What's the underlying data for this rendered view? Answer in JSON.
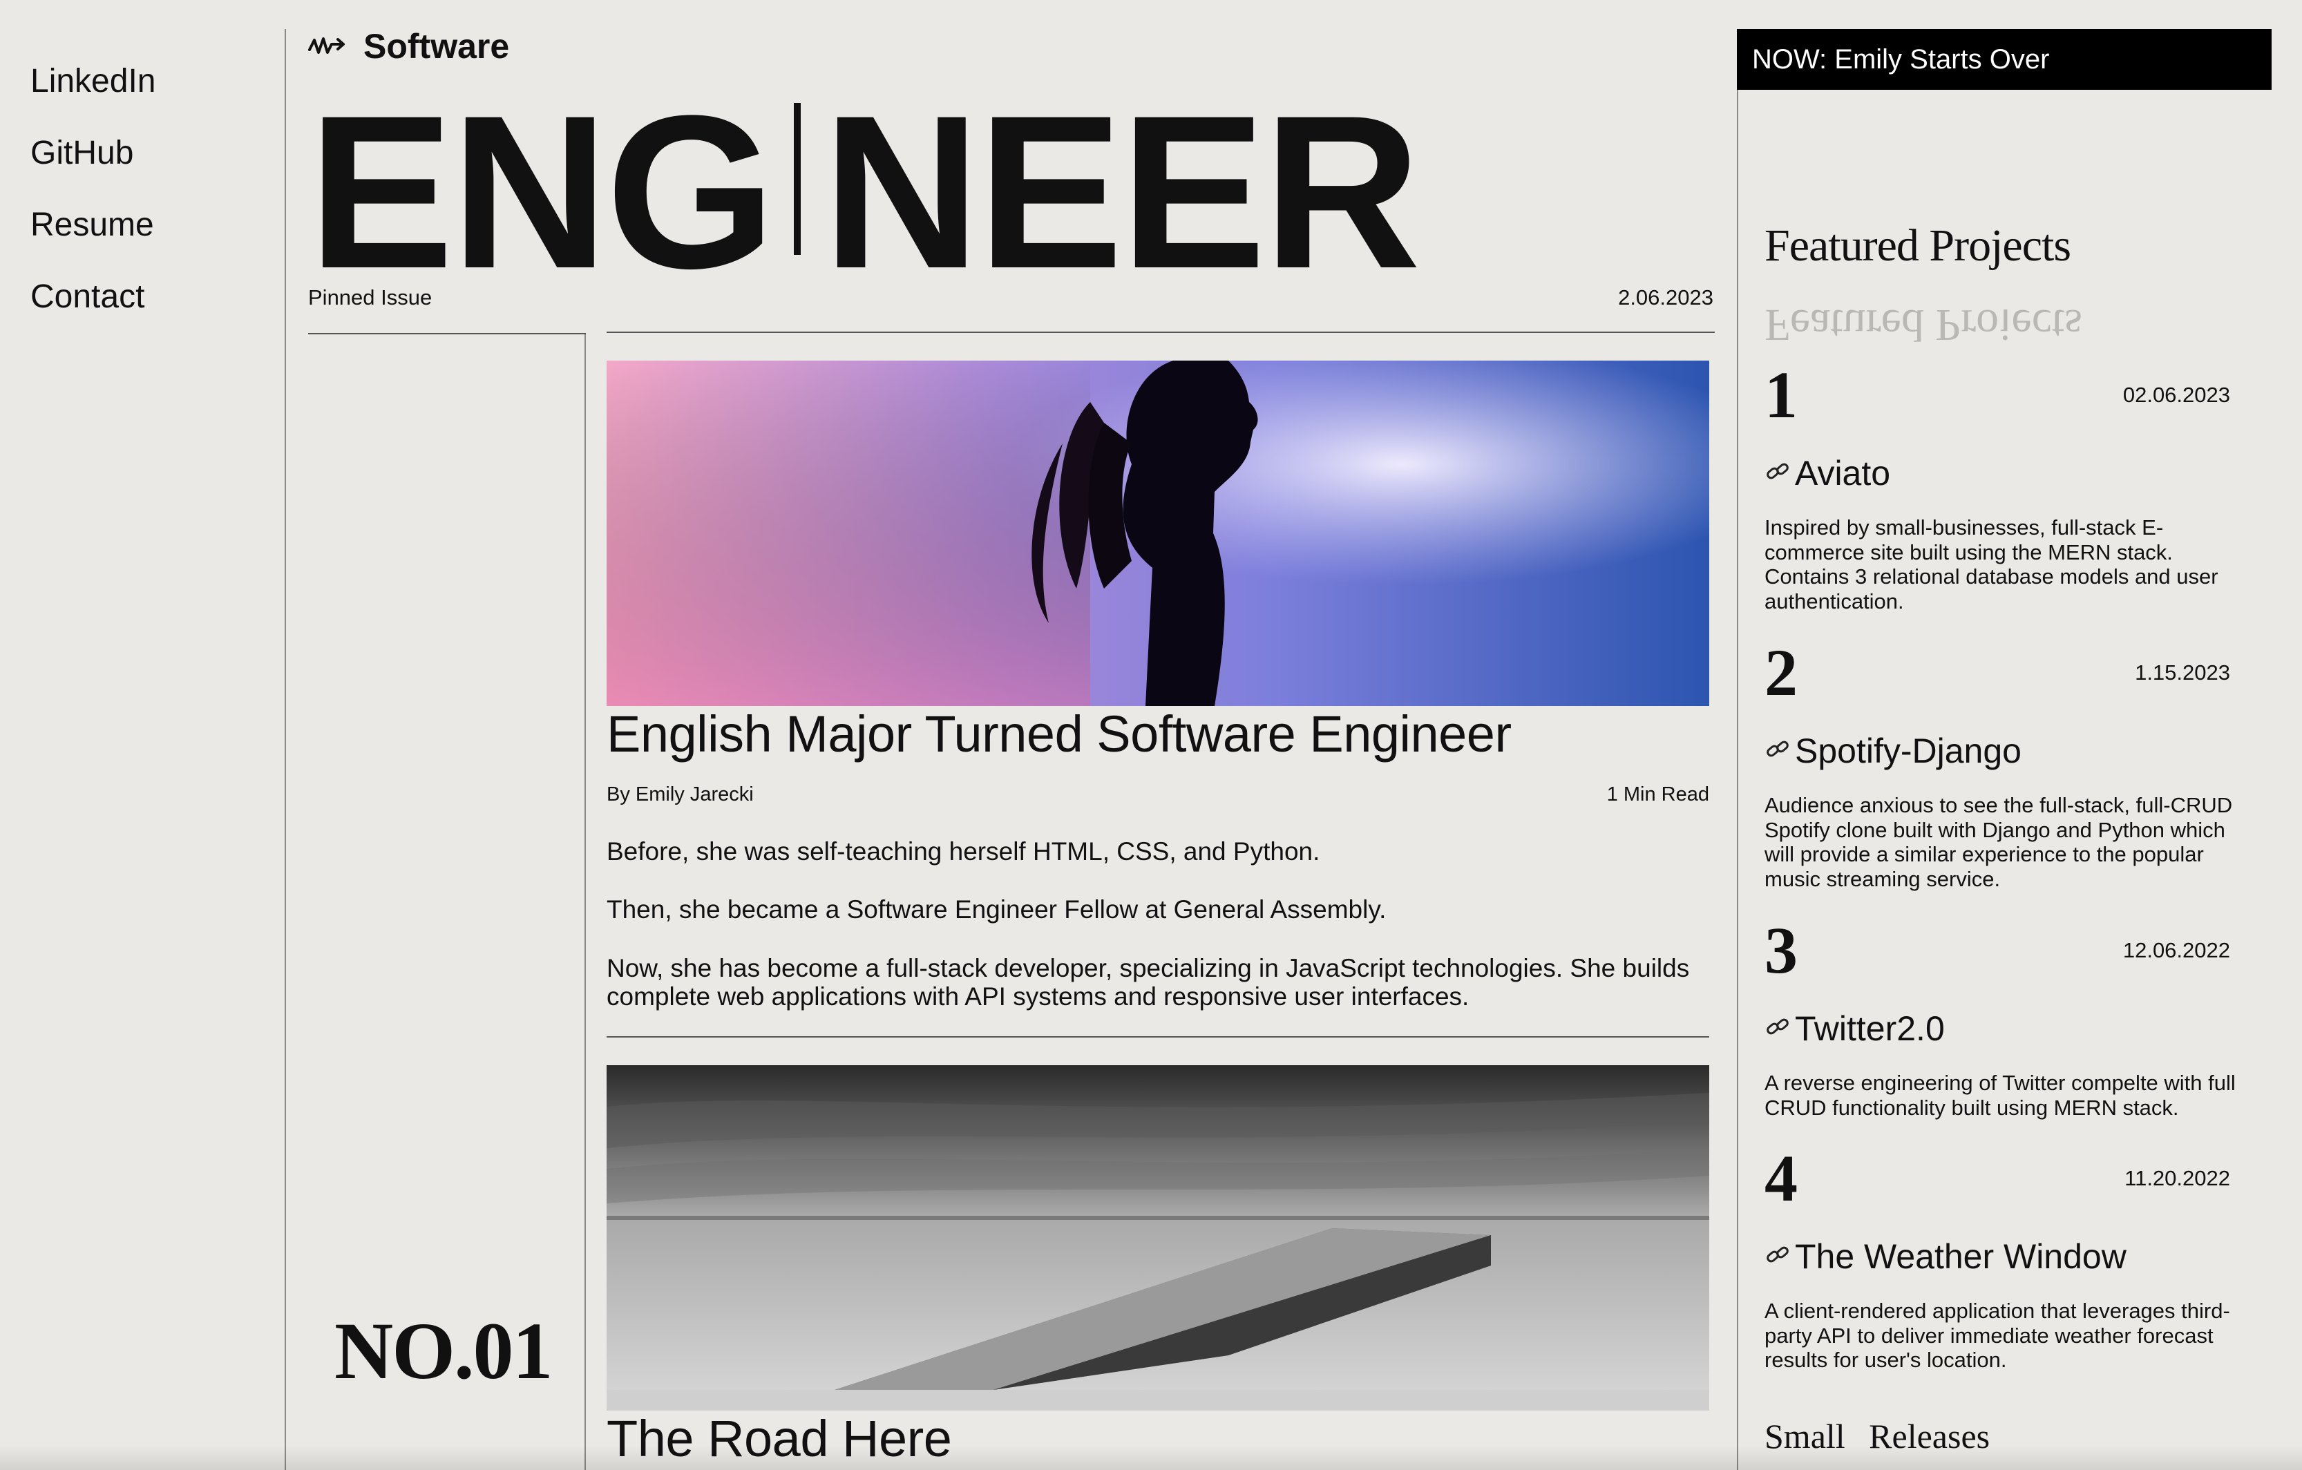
{
  "nav": {
    "items": [
      "LinkedIn",
      "GitHub",
      "Resume",
      "Contact"
    ]
  },
  "header": {
    "brand": "Software",
    "title_left": "ENG",
    "title_right": "NEER",
    "pinned_label": "Pinned Issue",
    "issue_date": "2.06.2023",
    "issue_number": "NO.01"
  },
  "article": {
    "title": "English Major Turned Software Engineer",
    "byline": "By Emily Jarecki",
    "read_time": "1 Min Read",
    "paragraphs": [
      "Before, she was self-teaching herself HTML, CSS, and Python.",
      "Then, she became a Software Engineer Fellow at General Assembly.",
      "Now, she has become a full-stack developer, specializing in JavaScript technologies. She builds complete web applications with API systems and responsive user interfaces."
    ]
  },
  "article2": {
    "title": "The Road Here"
  },
  "now_banner": "NOW: Emily Starts Over",
  "featured_heading": "Featured Projects",
  "projects": [
    {
      "number": "1",
      "date": "02.06.2023",
      "name": "Aviato",
      "description": "Inspired by small-businesses, full-stack E-commerce site built using the MERN stack. Contains 3 relational database models and user authentication."
    },
    {
      "number": "2",
      "date": "1.15.2023",
      "name": "Spotify-Django",
      "description": "Audience anxious to see the full-stack, full-CRUD Spotify clone built with Django and Python which will provide a similar experience to the popular music streaming service."
    },
    {
      "number": "3",
      "date": "12.06.2022",
      "name": "Twitter2.0",
      "description": "A reverse engineering of Twitter compelte with full CRUD functionality built using MERN stack."
    },
    {
      "number": "4",
      "date": "11.20.2022",
      "name": "The Weather Window",
      "description": "A client-rendered application that leverages third-party API to deliver immediate weather forecast results for user's location."
    }
  ],
  "small_releases_heading": "Small Releases",
  "icons": {
    "brand": "waveform-arrow-icon",
    "link": "link-icon"
  }
}
